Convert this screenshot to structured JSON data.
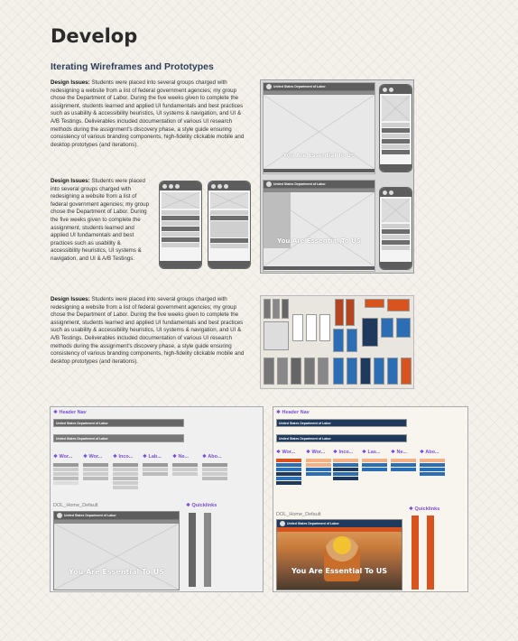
{
  "page": {
    "title": "Develop",
    "section_heading": "Iterating Wireframes and Prototypes"
  },
  "descriptions": [
    {
      "label": "Design Issues:",
      "text": "Students were placed into several groups charged with redesigning a website from a list of federal government agencies; my group chose the Department of Labor. During the five weeks given to complete the assignment, students learned and applied UI fundamentals and best practices such as usability & accessibility heuristics, UI systems & navigation, and UI & A/B Testings. Deliverables included documentation of various UI research methods during the assignment's discovery phase, a style guide ensuring consistency of various branding components, high-fidelity clickable mobile and desktop prototypes (and iterations)."
    },
    {
      "label": "Design Issues:",
      "text": "Students were placed into several groups charged with redesigning a website from a list of federal government agencies; my group chose the Department of Labor. During the five weeks given to complete the assignment, students learned and applied UI fundamentals and best practices such as usability & accessibility heuristics, UI systems & navigation, and UI & A/B Testings."
    },
    {
      "label": "Design Issues:",
      "text": "Students were placed into several groups charged with redesigning a website from a list of federal government agencies; my group chose the Department of Labor. During the five weeks given to complete the assignment, students learned and applied UI fundamentals and best practices such as usability & accessibility heuristics, UI systems & navigation, and UI & A/B Testings. Deliverables included documentation of various UI research methods during the assignment's discovery phase, a style guide ensuring consistency of various branding components, high-fidelity clickable mobile and desktop prototypes (and iterations)."
    }
  ],
  "wireframe": {
    "site_name": "United States Department of Labor",
    "hero_text": "You Are Essential To US"
  },
  "bottom": {
    "header_nav_label": "Header Nav",
    "columns_gray": [
      "Wor...",
      "Wor...",
      "Inco...",
      "Lab...",
      "Ne...",
      "Abo..."
    ],
    "columns_color": [
      "Wor...",
      "Wor...",
      "Inco...",
      "Las...",
      "Ne...",
      "Abo..."
    ],
    "home_label": "DOL_Home_Default",
    "quicklinks_label": "Quicklinks",
    "hero_text": "You Are Essential To US"
  },
  "colors": {
    "accent_purple": "#7a4fd6",
    "dol_navy": "#1f3a5c",
    "dol_orange": "#d9531e",
    "dol_blue": "#2c6eb5",
    "wire_gray": "#5d5d5d"
  }
}
